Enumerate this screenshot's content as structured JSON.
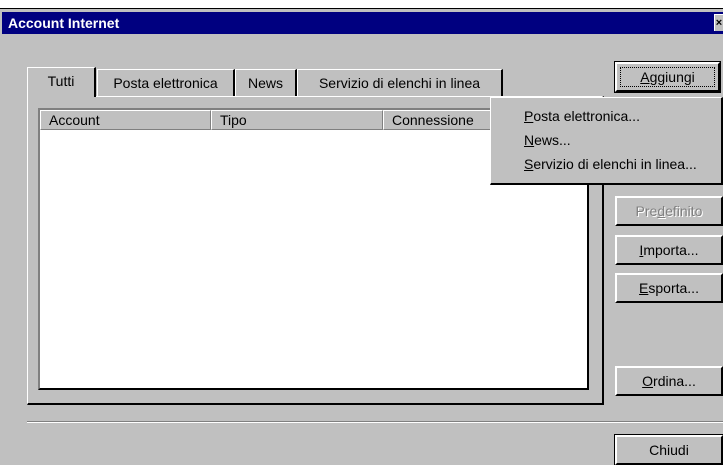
{
  "window": {
    "title": "Account Internet",
    "close_glyph": "×"
  },
  "tabs": [
    {
      "label": "Tutti"
    },
    {
      "label": "Posta elettronica"
    },
    {
      "label": "News"
    },
    {
      "label": "Servizio di elenchi in linea"
    }
  ],
  "list": {
    "columns": [
      {
        "label": "Account"
      },
      {
        "label": "Tipo"
      },
      {
        "label": "Connessione"
      }
    ]
  },
  "buttons": {
    "add": {
      "mnemonic": "A",
      "rest": "ggiungi"
    },
    "default": {
      "pre": "Pre",
      "mnemonic": "d",
      "rest": "efinito"
    },
    "import": {
      "mnemonic": "I",
      "rest": "mporta..."
    },
    "export": {
      "mnemonic": "E",
      "rest": "sporta..."
    },
    "order": {
      "mnemonic": "O",
      "rest": "rdina..."
    },
    "close": {
      "label": "Chiudi"
    }
  },
  "add_menu": {
    "items": [
      {
        "mnemonic": "P",
        "rest": "osta elettronica..."
      },
      {
        "mnemonic": "N",
        "rest": "ews..."
      },
      {
        "mnemonic": "S",
        "rest": "ervizio di elenchi in linea..."
      }
    ]
  }
}
